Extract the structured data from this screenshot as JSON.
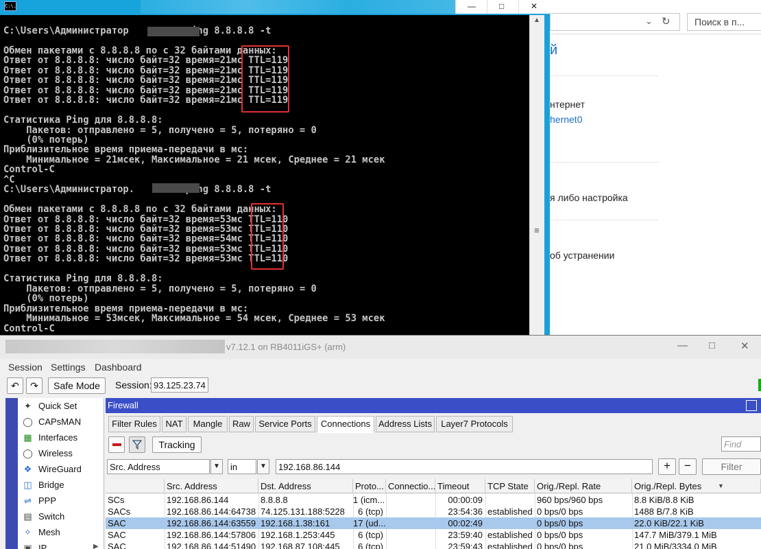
{
  "explorer": {
    "search_placeholder": "Поиск в п...",
    "heading_fragment": "й",
    "internet_text": "нтернет",
    "adapter_link": "hernet0",
    "config_text": "я либо настройка",
    "troubleshoot_text": "об устранении"
  },
  "cmd": {
    "icon_text": "C:\\.",
    "lines": [
      "C:\\Users\\Администратор          ping 8.8.8.8 -t",
      "",
      "Обмен пакетами с 8.8.8.8 по с 32 байтами данных:",
      "Ответ от 8.8.8.8: число байт=32 время=21мс TTL=119",
      "Ответ от 8.8.8.8: число байт=32 время=21мс TTL=119",
      "Ответ от 8.8.8.8: число байт=32 время=21мс TTL=119",
      "Ответ от 8.8.8.8: число байт=32 время=21мс TTL=119",
      "Ответ от 8.8.8.8: число байт=32 время=21мс TTL=119",
      "",
      "Статистика Ping для 8.8.8.8:",
      "    Пакетов: отправлено = 5, получено = 5, потеряно = 0",
      "    (0% потерь)",
      "Приблизительное время приема-передачи в мс:",
      "    Минимальное = 21мсек, Максимальное = 21 мсек, Среднее = 21 мсек",
      "Control-C",
      "^C",
      "C:\\Users\\Администратор.         ping 8.8.8.8 -t",
      "",
      "Обмен пакетами с 8.8.8.8 по с 32 байтами данных:",
      "Ответ от 8.8.8.8: число байт=32 время=53мс TTL=110",
      "Ответ от 8.8.8.8: число байт=32 время=53мс TTL=110",
      "Ответ от 8.8.8.8: число байт=32 время=54мс TTL=110",
      "Ответ от 8.8.8.8: число байт=32 время=53мс TTL=110",
      "Ответ от 8.8.8.8: число байт=32 время=53мс TTL=110",
      "",
      "Статистика Ping для 8.8.8.8:",
      "    Пакетов: отправлено = 5, получено = 5, потеряно = 0",
      "    (0% потерь)",
      "Приблизительное время приема-передачи в мс:",
      "    Минимальное = 53мсек, Максимальное = 54 мсек, Среднее = 53 мсек",
      "Control-C"
    ]
  },
  "winbox": {
    "title": "v7.12.1 on RB4011iGS+ (arm)",
    "menu": [
      "Session",
      "Settings",
      "Dashboard"
    ],
    "safe_mode_label": "Safe Mode",
    "session_label": "Session:",
    "session_value": "93.125.23.74",
    "sidebar": [
      {
        "label": "Quick Set",
        "icon": "quick-set-icon"
      },
      {
        "label": "CAPsMAN",
        "icon": "capsman-icon"
      },
      {
        "label": "Interfaces",
        "icon": "interfaces-icon"
      },
      {
        "label": "Wireless",
        "icon": "wireless-icon"
      },
      {
        "label": "WireGuard",
        "icon": "wireguard-icon"
      },
      {
        "label": "Bridge",
        "icon": "bridge-icon"
      },
      {
        "label": "PPP",
        "icon": "ppp-icon"
      },
      {
        "label": "Switch",
        "icon": "switch-icon"
      },
      {
        "label": "Mesh",
        "icon": "mesh-icon"
      },
      {
        "label": "IP",
        "icon": "ip-icon"
      }
    ],
    "firewall": {
      "title": "Firewall",
      "tabs": [
        "Filter Rules",
        "NAT",
        "Mangle",
        "Raw",
        "Service Ports",
        "Connections",
        "Address Lists",
        "Layer7 Protocols"
      ],
      "active_tab": "Connections",
      "tracking_label": "Tracking",
      "find_placeholder": "Find",
      "filter_field": "Src. Address",
      "filter_operator": "in",
      "filter_value": "192.168.86.144",
      "filter_button": "Filter",
      "columns": [
        "",
        "Src. Address",
        "Dst. Address",
        "Proto...",
        "Connectio...",
        "Timeout",
        "TCP State",
        "Orig./Repl. Rate",
        "Orig./Repl. Bytes"
      ],
      "rows": [
        {
          "flags": "SCs",
          "src": "192.168.86.144",
          "dst": "8.8.8.8",
          "proto": "1 (icm...",
          "conn": "",
          "timeout": "00:00:09",
          "state": "",
          "rate": "960 bps/960 bps",
          "bytes": "8.8 KiB/8.8 KiB",
          "selected": false
        },
        {
          "flags": "SACs",
          "src": "192.168.86.144:64738",
          "dst": "74.125.131.188:5228",
          "proto": "6 (tcp)",
          "conn": "",
          "timeout": "23:54:36",
          "state": "established",
          "rate": "0 bps/0 bps",
          "bytes": "1488 B/7.8 KiB",
          "selected": false
        },
        {
          "flags": "SAC",
          "src": "192.168.86.144:63559",
          "dst": "192.168.1.38:161",
          "proto": "17 (ud...",
          "conn": "",
          "timeout": "00:02:49",
          "state": "",
          "rate": "0 bps/0 bps",
          "bytes": "22.0 KiB/22.1 KiB",
          "selected": true
        },
        {
          "flags": "SAC",
          "src": "192.168.86.144:57806",
          "dst": "192.168.1.253:445",
          "proto": "6 (tcp)",
          "conn": "",
          "timeout": "23:59:40",
          "state": "established",
          "rate": "0 bps/0 bps",
          "bytes": "147.7 MiB/379.1 MiB",
          "selected": false
        },
        {
          "flags": "SAC",
          "src": "192.168.86.144:51490",
          "dst": "192.168.87.108:445",
          "proto": "6 (tcp)",
          "conn": "",
          "timeout": "23:59:43",
          "state": "established",
          "rate": "0 bps/0 bps",
          "bytes": "21.0 MiB/3334.0 MiB",
          "selected": false
        }
      ]
    }
  }
}
